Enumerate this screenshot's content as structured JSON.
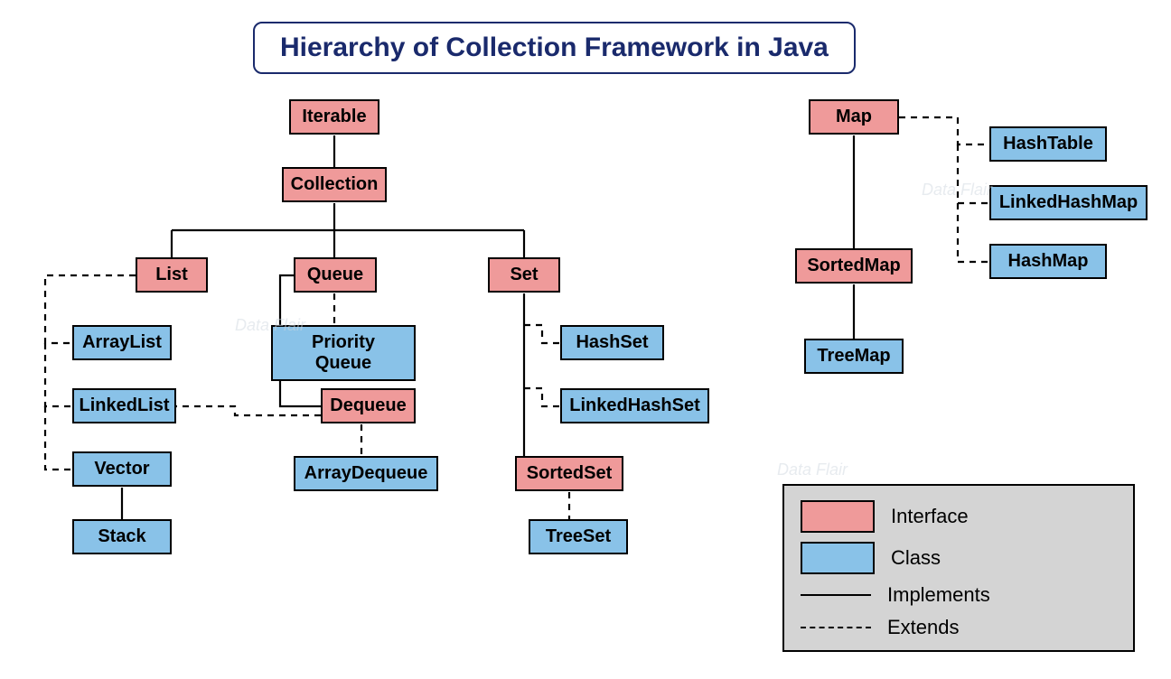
{
  "title": "Hierarchy of Collection Framework in Java",
  "nodes": {
    "iterable": {
      "label": "Iterable",
      "kind": "interface"
    },
    "collection": {
      "label": "Collection",
      "kind": "interface"
    },
    "list": {
      "label": "List",
      "kind": "interface"
    },
    "queue": {
      "label": "Queue",
      "kind": "interface"
    },
    "set": {
      "label": "Set",
      "kind": "interface"
    },
    "arraylist": {
      "label": "ArrayList",
      "kind": "class"
    },
    "linkedlist": {
      "label": "LinkedList",
      "kind": "class"
    },
    "vector": {
      "label": "Vector",
      "kind": "class"
    },
    "stack": {
      "label": "Stack",
      "kind": "class"
    },
    "priorityqueue": {
      "label": "Priority Queue",
      "kind": "class"
    },
    "dequeue": {
      "label": "Dequeue",
      "kind": "interface"
    },
    "arraydequeue": {
      "label": "ArrayDequeue",
      "kind": "class"
    },
    "hashset": {
      "label": "HashSet",
      "kind": "class"
    },
    "linkedhashset": {
      "label": "LinkedHashSet",
      "kind": "class"
    },
    "sortedset": {
      "label": "SortedSet",
      "kind": "interface"
    },
    "treeset": {
      "label": "TreeSet",
      "kind": "class"
    },
    "map": {
      "label": "Map",
      "kind": "interface"
    },
    "sortedmap": {
      "label": "SortedMap",
      "kind": "interface"
    },
    "treemap": {
      "label": "TreeMap",
      "kind": "class"
    },
    "hashtable": {
      "label": "HashTable",
      "kind": "class"
    },
    "linkedhashmap": {
      "label": "LinkedHashMap",
      "kind": "class"
    },
    "hashmap": {
      "label": "HashMap",
      "kind": "class"
    }
  },
  "legend": {
    "interface_label": "Interface",
    "class_label": "Class",
    "implements_label": "Implements",
    "extends_label": "Extends"
  },
  "colors": {
    "interface_fill": "#ef9a9a",
    "class_fill": "#89c2e8",
    "title_border": "#1a2a6c"
  },
  "edges": [
    {
      "from": "iterable",
      "to": "collection",
      "style": "solid"
    },
    {
      "from": "collection",
      "to": "list",
      "style": "solid"
    },
    {
      "from": "collection",
      "to": "queue",
      "style": "solid"
    },
    {
      "from": "collection",
      "to": "set",
      "style": "solid"
    },
    {
      "from": "list",
      "to": "arraylist",
      "style": "dashed"
    },
    {
      "from": "list",
      "to": "linkedlist",
      "style": "dashed"
    },
    {
      "from": "list",
      "to": "vector",
      "style": "dashed"
    },
    {
      "from": "vector",
      "to": "stack",
      "style": "solid"
    },
    {
      "from": "queue",
      "to": "priorityqueue",
      "style": "dashed"
    },
    {
      "from": "queue",
      "to": "dequeue",
      "style": "solid"
    },
    {
      "from": "dequeue",
      "to": "arraydequeue",
      "style": "dashed"
    },
    {
      "from": "dequeue",
      "to": "linkedlist",
      "style": "dashed"
    },
    {
      "from": "set",
      "to": "hashset",
      "style": "dashed"
    },
    {
      "from": "set",
      "to": "linkedhashset",
      "style": "dashed"
    },
    {
      "from": "set",
      "to": "sortedset",
      "style": "solid"
    },
    {
      "from": "sortedset",
      "to": "treeset",
      "style": "dashed"
    },
    {
      "from": "map",
      "to": "sortedmap",
      "style": "solid"
    },
    {
      "from": "sortedmap",
      "to": "treemap",
      "style": "solid"
    },
    {
      "from": "map",
      "to": "hashtable",
      "style": "dashed"
    },
    {
      "from": "map",
      "to": "linkedhashmap",
      "style": "dashed"
    },
    {
      "from": "map",
      "to": "hashmap",
      "style": "dashed"
    }
  ]
}
